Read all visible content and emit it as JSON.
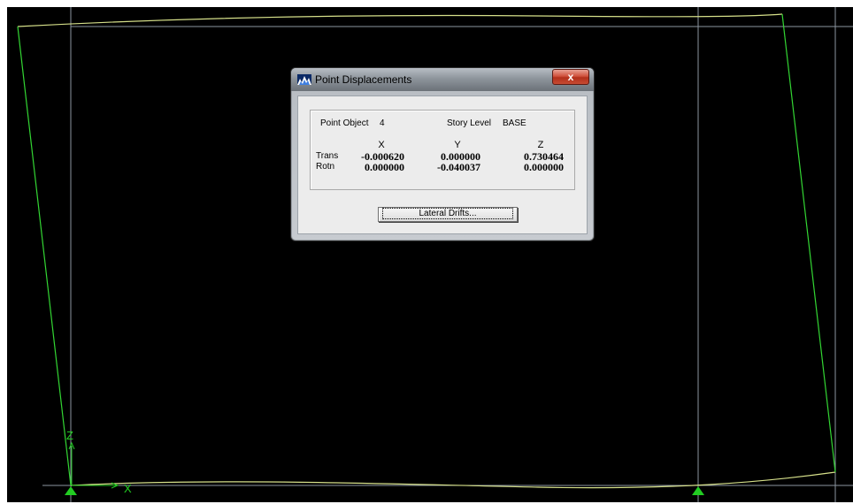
{
  "viewport": {
    "axis_labels": {
      "z": "Z",
      "x": "X"
    },
    "colors": {
      "background": "#000000",
      "gridline": "#8c96a0",
      "deformed_frame": "#d6e08a",
      "frame": "#33d633",
      "support": "#22cc22",
      "axis": "#22cc22"
    }
  },
  "dialog": {
    "title": "Point Displacements",
    "close_label": "x",
    "app_icon": "mountain-chart-icon",
    "point_object_label": "Point Object",
    "point_object_value": "4",
    "story_level_label": "Story Level",
    "story_level_value": "BASE",
    "columns": [
      "X",
      "Y",
      "Z"
    ],
    "rows": [
      {
        "label": "Trans",
        "values": [
          "-0.000620",
          "0.000000",
          "0.730464"
        ]
      },
      {
        "label": "Rotn",
        "values": [
          "0.000000",
          "-0.040037",
          "0.000000"
        ]
      }
    ],
    "lateral_drifts_label": "Lateral Drifts..."
  }
}
